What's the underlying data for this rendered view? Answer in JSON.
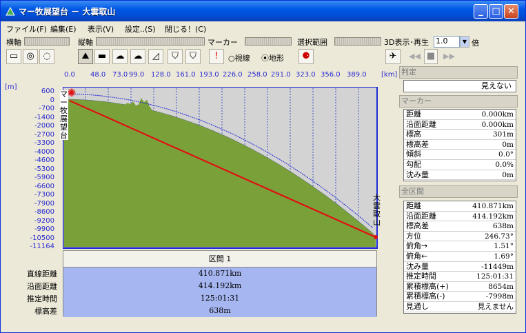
{
  "window": {
    "title": "マー牧展望台 － 大雲取山",
    "btn_min": "_",
    "btn_max": "□",
    "btn_close": "✕"
  },
  "menu": [
    "ファイル(F)",
    "編集(E)",
    "表示(V)",
    "設定..(S)",
    "閉じる！(C)"
  ],
  "toolbar": {
    "horizontal_label": "横軸",
    "vertical_label": "縦軸",
    "marker_label": "マーカー",
    "range_label": "選択範囲",
    "display3d_label": "3D表示･再生",
    "speed_value": "1.0",
    "speed_unit": "倍",
    "radio_sight": "視線",
    "radio_terrain": "地形",
    "radio_selected": "地形"
  },
  "scale": {
    "unit": "[km]",
    "ticks": [
      "0.0",
      "48.0",
      "73.0",
      "99.0",
      "128.0",
      "161.0",
      "193.0",
      "226.0",
      "258.0",
      "291.0",
      "323.0",
      "356.0",
      "389.0"
    ]
  },
  "yaxis": {
    "unit": "[m]",
    "ticks": [
      "600",
      "0",
      "-700",
      "-1400",
      "-2000",
      "-2700",
      "-3300",
      "-4000",
      "-4600",
      "-5300",
      "-5900",
      "-6600",
      "-7300",
      "-7900",
      "-8600",
      "-9200",
      "-9900",
      "-10500",
      "-11164"
    ]
  },
  "points": {
    "start": "マー牧展望台",
    "end": "大雲取山"
  },
  "section": {
    "header": "区間 1",
    "labels": [
      "直線距離",
      "沿面距離",
      "推定時間",
      "標高差"
    ],
    "values": [
      "410.871km",
      "414.192km",
      "125:01:31",
      "638m"
    ]
  },
  "right": {
    "judge_header": "判定",
    "judge_value": "見えない",
    "marker_header": "マーカー",
    "marker_rows": [
      [
        "距離",
        "0.000km"
      ],
      [
        "沿面距離",
        "0.000km"
      ],
      [
        "標高",
        "301m"
      ],
      [
        "標高差",
        "0m"
      ],
      [
        "傾斜",
        "0.0°"
      ],
      [
        "勾配",
        "0.0%"
      ],
      [
        "沈み量",
        "0m"
      ]
    ],
    "all_header": "全区間",
    "all_rows": [
      [
        "距離",
        "410.871km"
      ],
      [
        "沿面距離",
        "414.192km"
      ],
      [
        "標高差",
        "638m"
      ],
      [
        "方位",
        "246.73°"
      ],
      [
        "俯角→",
        "1.51°"
      ],
      [
        "俯角←",
        "1.69°"
      ],
      [
        "沈み量",
        "-11449m"
      ],
      [
        "推定時間",
        "125:01:31"
      ],
      [
        "累積標高(+)",
        "8654m"
      ],
      [
        "累積標高(-)",
        "-7998m"
      ],
      [
        "見通し",
        "見えません"
      ]
    ]
  },
  "colors": {
    "title": "#0058e6",
    "terrain": "#5e8a2b",
    "sight_line": "#e00000",
    "section_rows": "#a6b6f0",
    "axis_text": "#2a2ad0"
  }
}
